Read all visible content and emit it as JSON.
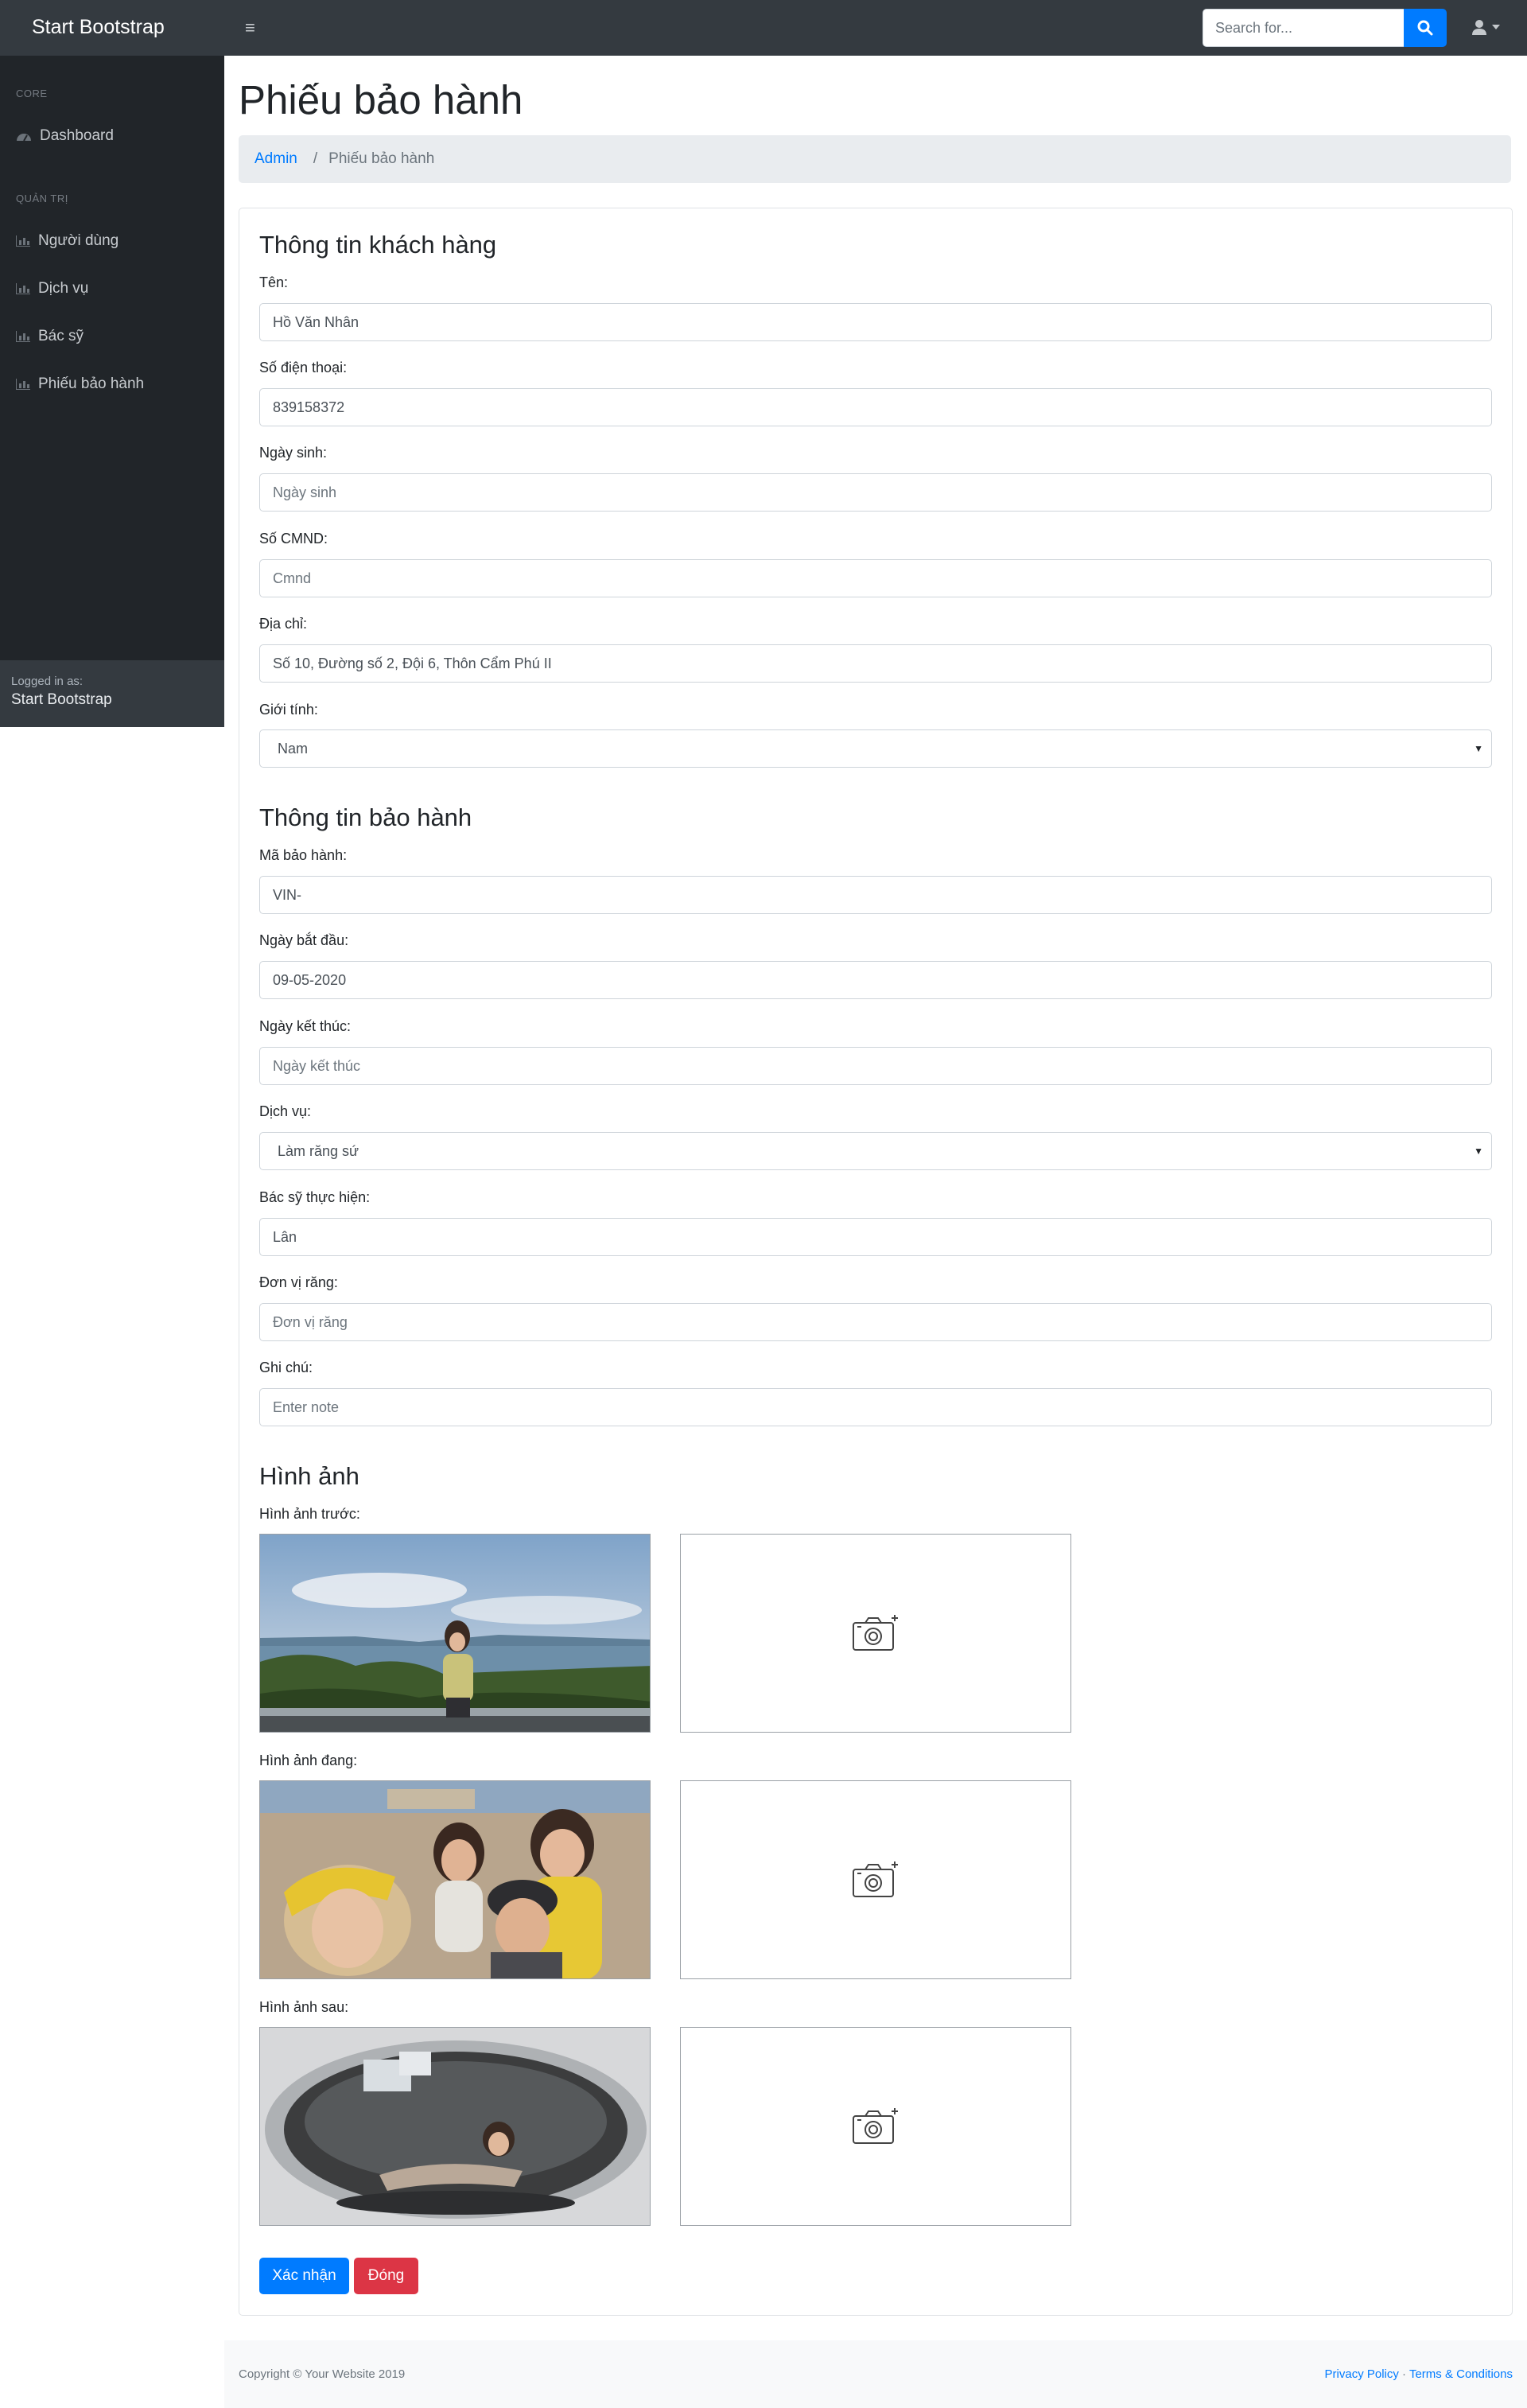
{
  "navbar": {
    "brand": "Start Bootstrap",
    "search_placeholder": "Search for..."
  },
  "sidebar": {
    "heading_core": "Core",
    "dashboard": "Dashboard",
    "heading_admin": "Quản trị",
    "items": [
      "Người dùng",
      "Dịch vụ",
      "Bác sỹ",
      "Phiếu bảo hành"
    ],
    "footer_small": "Logged in as:",
    "footer_user": "Start Bootstrap"
  },
  "page": {
    "title": "Phiếu bảo hành",
    "breadcrumb_link": "Admin",
    "breadcrumb_sep": "/",
    "breadcrumb_active": "Phiếu bảo hành"
  },
  "customer": {
    "title": "Thông tin khách hàng",
    "name_label": "Tên:",
    "name_value": "Hồ Văn Nhân",
    "phone_label": "Số điện thoại:",
    "phone_value": "839158372",
    "dob_label": "Ngày sinh:",
    "dob_placeholder": "Ngày sinh",
    "id_label": "Số CMND:",
    "id_placeholder": "Cmnd",
    "address_label": "Địa chỉ:",
    "address_value": "Số 10, Đường số 2, Đội 6,  Thôn Cẩm Phú II",
    "gender_label": "Giới tính:",
    "gender_value": "Nam"
  },
  "warranty": {
    "title": "Thông tin bảo hành",
    "code_label": "Mã bảo hành:",
    "code_value": "VIN-",
    "start_label": "Ngày bắt đầu:",
    "start_value": "09-05-2020",
    "end_label": "Ngày kết thúc:",
    "end_placeholder": "Ngày kết thúc",
    "service_label": "Dịch vụ:",
    "service_value": "Làm răng sứ",
    "doctor_label": "Bác sỹ thực hiện:",
    "doctor_value": "Lân",
    "unit_label": "Đơn vị răng:",
    "unit_placeholder": "Đơn vị răng",
    "note_label": "Ghi chú:",
    "note_placeholder": "Enter note"
  },
  "images": {
    "title": "Hình ảnh",
    "before_label": "Hình ảnh trước:",
    "during_label": "Hình ảnh đang:",
    "after_label": "Hình ảnh sau:"
  },
  "actions": {
    "confirm": "Xác nhận",
    "close": "Đóng"
  },
  "footer": {
    "copyright": "Copyright © Your Website 2019",
    "privacy": "Privacy Policy",
    "dot": " · ",
    "terms": "Terms & Conditions"
  },
  "colors": {
    "primary": "#007bff",
    "danger": "#dc3545",
    "navbar": "#343a40",
    "sidebar": "#212529"
  }
}
